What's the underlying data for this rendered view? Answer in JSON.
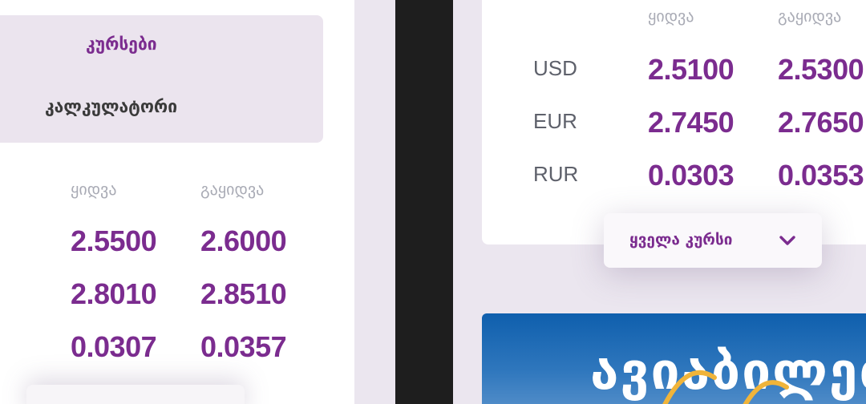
{
  "left_panel": {
    "tabs": {
      "rates_label": "კურსები",
      "calculator_label": "კალკულატორი"
    },
    "columns": {
      "buy": "ყიდვა",
      "sell": "გაყიდვა"
    },
    "rows": [
      {
        "buy": "2.5500",
        "sell": "2.6000"
      },
      {
        "buy": "2.8010",
        "sell": "2.8510"
      },
      {
        "buy": "0.0307",
        "sell": "0.0357"
      }
    ]
  },
  "right_panel": {
    "columns": {
      "buy": "ყიდვა",
      "sell": "გაყიდვა"
    },
    "rows": [
      {
        "currency": "USD",
        "buy": "2.5100",
        "sell": "2.5300"
      },
      {
        "currency": "EUR",
        "buy": "2.7450",
        "sell": "2.7650"
      },
      {
        "currency": "RUR",
        "buy": "0.0303",
        "sell": "0.0353"
      }
    ],
    "all_rates_button": "ყველა კურსი",
    "banner_text": "ავიაბილეთ"
  },
  "colors": {
    "accent": "#7b2c8f",
    "muted_text": "#a9abb5",
    "background": "#ebe6ef",
    "banner_blue": "#0f5fad"
  },
  "icons": {
    "all_rates_button_icon": "chevron-down-icon",
    "banner_decoration": "airplane-arc-icon"
  }
}
